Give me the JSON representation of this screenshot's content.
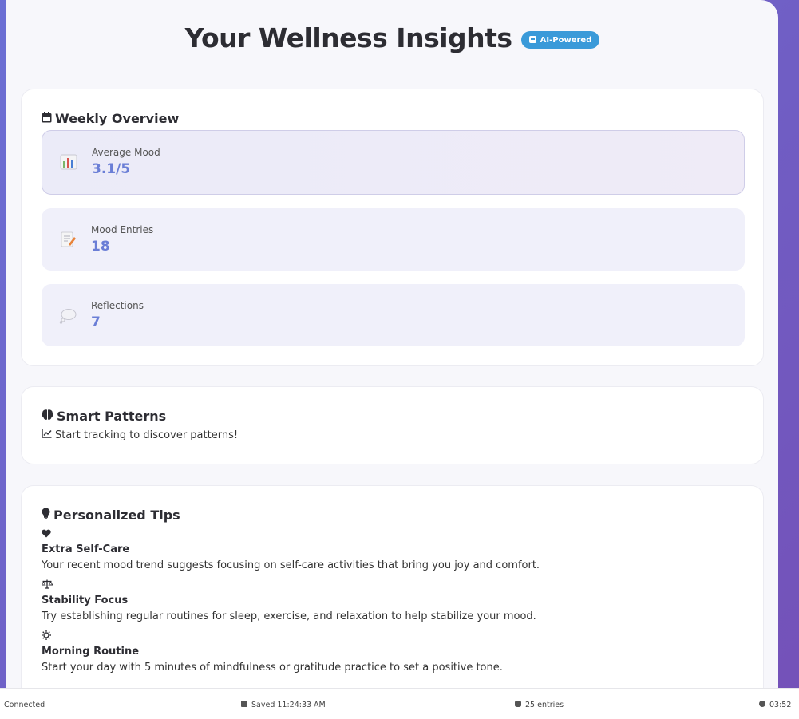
{
  "header": {
    "title": "Your Wellness Insights",
    "badge": "AI-Powered"
  },
  "weekly": {
    "title": "Weekly Overview",
    "stats": [
      {
        "label": "Average Mood",
        "value": "3.1/5",
        "icon": "bar-chart-icon"
      },
      {
        "label": "Mood Entries",
        "value": "18",
        "icon": "memo-icon"
      },
      {
        "label": "Reflections",
        "value": "7",
        "icon": "thought-bubble-icon"
      }
    ]
  },
  "patterns": {
    "title": "Smart Patterns",
    "text": "Start tracking to discover patterns!"
  },
  "tips": {
    "title": "Personalized Tips",
    "items": [
      {
        "icon": "heart-icon",
        "title": "Extra Self-Care",
        "text": "Your recent mood trend suggests focusing on self-care activities that bring you joy and comfort."
      },
      {
        "icon": "balance-scale-icon",
        "title": "Stability Focus",
        "text": "Try establishing regular routines for sleep, exercise, and relaxation to help stabilize your mood."
      },
      {
        "icon": "sun-icon",
        "title": "Morning Routine",
        "text": "Start your day with 5 minutes of mindfulness or gratitude practice to set a positive tone."
      }
    ]
  },
  "statusbar": {
    "connection": "Connected",
    "saved": "Saved 11:24:33 AM",
    "entries": "25 entries",
    "time": "03:52"
  },
  "colors": {
    "accent": "#6a7ed6",
    "badge": "#3a9ad9",
    "background_start": "#6b6fd4",
    "background_end": "#7451b8"
  }
}
